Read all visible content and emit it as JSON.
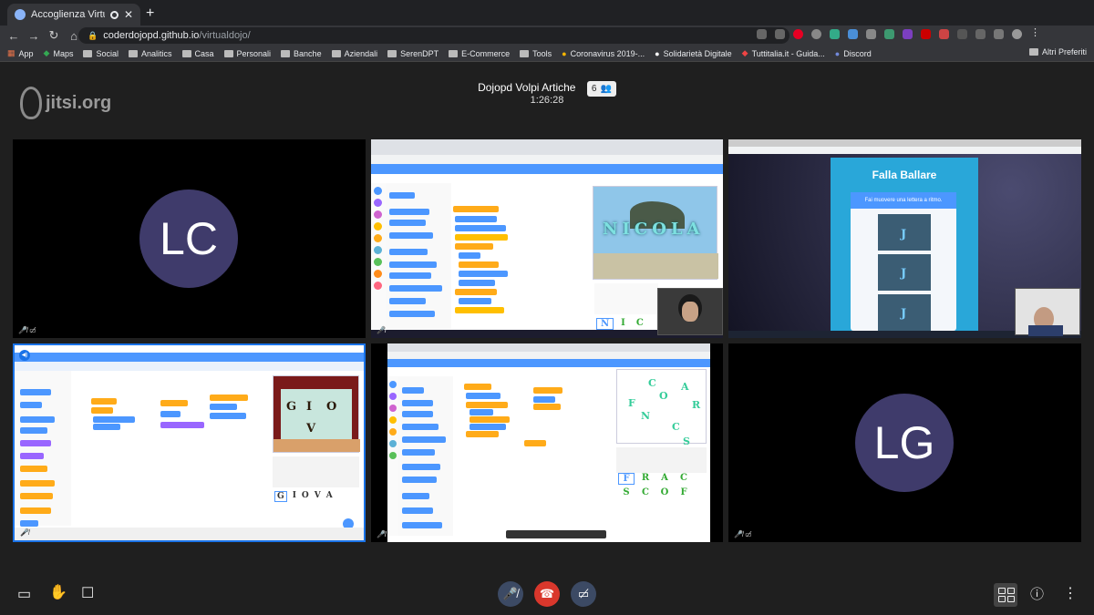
{
  "browser": {
    "tab_title": "Accoglienza Virtual Dojo",
    "new_tab": "+",
    "url_domain": "coderdojopd.github.io",
    "url_path": "/virtualdojo/",
    "bookmarks": [
      "App",
      "Maps",
      "Social",
      "Analitics",
      "Casa",
      "Personali",
      "Banche",
      "Aziendali",
      "SerenDPT",
      "E-Commerce",
      "Tools",
      "Coronavirus 2019-...",
      "Solidarietà Digitale",
      "Tuttitalia.it - Guida...",
      "Discord"
    ],
    "bookmarks_other": "Altri Preferiti"
  },
  "meeting": {
    "logo": "jitsi.org",
    "title": "Dojopd Volpi Artiche",
    "participant_count": "6",
    "timer": "1:26:28"
  },
  "tiles": {
    "lc": {
      "initials": "LC"
    },
    "lg": {
      "initials": "LG"
    },
    "screen1": {
      "stage_text": "NICOLA",
      "letters": [
        "N",
        "I",
        "C"
      ]
    },
    "screen2": {
      "title": "Falla Ballare",
      "subtitle": "Fai muovere una lettera a ritmo.",
      "letters": [
        "J",
        "J",
        "J"
      ]
    },
    "screen3": {
      "letters": [
        "G",
        "I",
        "O",
        "V",
        "A"
      ],
      "stage_letters": [
        "G",
        "I",
        "O",
        "V"
      ]
    },
    "screen4": {
      "sprite_letters": [
        "F",
        "R",
        "A",
        "C",
        "S",
        "C",
        "O",
        "F"
      ],
      "stage_letters": [
        "F",
        "C",
        "A",
        "N",
        "R",
        "O",
        "C",
        "S"
      ]
    }
  },
  "colors": {
    "accent": "#1a73e8",
    "avatar": "#3f3b6b",
    "hangup": "#d9372c"
  }
}
